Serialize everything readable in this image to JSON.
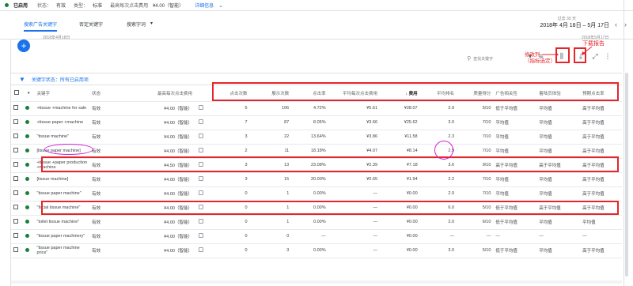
{
  "topbar": {
    "status": "已启用",
    "state_label": "状态：",
    "state_value": "有效",
    "type_label": "类型：",
    "type_value": "标准",
    "max_cpc_label": "最高每次点击费用",
    "max_cpc_value": "¥4.00（智能）",
    "details_link": "详细信息"
  },
  "tabs": [
    "搜索广告关键字",
    "否定关键字",
    "搜索字词"
  ],
  "date_panel": {
    "range_label": "过去 30 天",
    "range": "2018年 4月 18日 – 5月 17日"
  },
  "chart_dates": {
    "left": "2018年4月18日",
    "right": "2018年5月17日"
  },
  "toolbar": {
    "search_placeholder": "查找关键字",
    "annotation_columns": "修改列\n（指标选定）",
    "annotation_download": "下载报告"
  },
  "filter": {
    "text": "关键字状态：所有已启用项"
  },
  "table": {
    "columns": [
      "关键字",
      "状态",
      "最高每次点击费用",
      "点击次数",
      "展示次数",
      "点击率",
      "平均每次点击费用",
      "费用",
      "平均排名",
      "质量得分",
      "广告相关性",
      "着陆页体验",
      "预期点击率"
    ],
    "rows": [
      {
        "kw": "+tissue +machine for sale",
        "status": "有效",
        "cpc": "¥4.00（智能）",
        "clicks": "5",
        "impr": "106",
        "ctr": "4.72%",
        "avg_cpc": "¥5.61",
        "cost": "¥28.07",
        "pos": "2.9",
        "qs": "5/10",
        "rel": "低于平均值",
        "land": "平均值",
        "exp": "高于平均值"
      },
      {
        "kw": "+tissue paper +machine",
        "status": "有效",
        "cpc": "¥4.00（智能）",
        "clicks": "7",
        "impr": "87",
        "ctr": "8.05%",
        "avg_cpc": "¥3.66",
        "cost": "¥25.62",
        "pos": "3.0",
        "qs": "7/10",
        "rel": "平均值",
        "land": "平均值",
        "exp": "高于平均值"
      },
      {
        "kw": "\"tissue machine\"",
        "status": "有效",
        "cpc": "¥4.00（智能）",
        "clicks": "3",
        "impr": "22",
        "ctr": "13.64%",
        "avg_cpc": "¥3.86",
        "cost": "¥11.58",
        "pos": "2.3",
        "qs": "7/10",
        "rel": "平均值",
        "land": "平均值",
        "exp": "高于平均值"
      },
      {
        "kw": "[tissue paper machine]",
        "status": "有效",
        "cpc": "¥4.00（智能）",
        "clicks": "2",
        "impr": "11",
        "ctr": "18.18%",
        "avg_cpc": "¥4.07",
        "cost": "¥8.14",
        "pos": "2.9",
        "qs": "7/10",
        "rel": "平均值",
        "land": "平均值",
        "exp": "高于平均值"
      },
      {
        "kw": "+tissue +paper production +machine",
        "status": "有效",
        "cpc": "¥4.50（智能）",
        "clicks": "3",
        "impr": "13",
        "ctr": "23.08%",
        "avg_cpc": "¥2.39",
        "cost": "¥7.18",
        "pos": "3.6",
        "qs": "9/10",
        "rel": "高于平均值",
        "land": "高于平均值",
        "exp": "高于平均值"
      },
      {
        "kw": "[tissue machine]",
        "status": "有效",
        "cpc": "¥4.00（智能）",
        "clicks": "3",
        "impr": "15",
        "ctr": "20.00%",
        "avg_cpc": "¥0.65",
        "cost": "¥1.94",
        "pos": "2.2",
        "qs": "7/10",
        "rel": "平均值",
        "land": "平均值",
        "exp": "高于平均值"
      },
      {
        "kw": "\"tissue paper machine\"",
        "status": "有效",
        "cpc": "¥4.00（智能）",
        "clicks": "0",
        "impr": "1",
        "ctr": "0.00%",
        "avg_cpc": "—",
        "cost": "¥0.00",
        "pos": "2.0",
        "qs": "7/10",
        "rel": "平均值",
        "land": "平均值",
        "exp": "高于平均值"
      },
      {
        "kw": "\"facial tissue machine\"",
        "status": "有效",
        "cpc": "¥4.00（智能）",
        "clicks": "0",
        "impr": "1",
        "ctr": "0.00%",
        "avg_cpc": "—",
        "cost": "¥0.00",
        "pos": "6.0",
        "qs": "5/10",
        "rel": "低于平均值",
        "land": "高于平均值",
        "exp": "高于平均值"
      },
      {
        "kw": "\"toilet tissue machine\"",
        "status": "有效",
        "cpc": "¥4.00（智能）",
        "clicks": "0",
        "impr": "1",
        "ctr": "0.00%",
        "avg_cpc": "—",
        "cost": "¥0.00",
        "pos": "2.0",
        "qs": "6/10",
        "rel": "低于平均值",
        "land": "平均值",
        "exp": "平均值"
      },
      {
        "kw": "\"tissue paper machinery\"",
        "status": "有效",
        "cpc": "¥4.00（智能）",
        "clicks": "0",
        "impr": "0",
        "ctr": "—",
        "avg_cpc": "—",
        "cost": "¥0.00",
        "pos": "—",
        "qs": "—",
        "rel": "—",
        "land": "—",
        "exp": "—"
      },
      {
        "kw": "\"tissue paper machine price\"",
        "status": "有效",
        "cpc": "¥4.00（智能）",
        "clicks": "0",
        "impr": "3",
        "ctr": "0.00%",
        "avg_cpc": "—",
        "cost": "¥0.00",
        "pos": "3.0",
        "qs": "5/10",
        "rel": "低于平均值",
        "land": "平均值",
        "exp": "高于平均值"
      }
    ]
  },
  "colors": {
    "accent": "#1a73e8",
    "annotation_red": "#e5252a",
    "annotation_purple": "#d21fd6",
    "enabled_green": "#188038"
  }
}
